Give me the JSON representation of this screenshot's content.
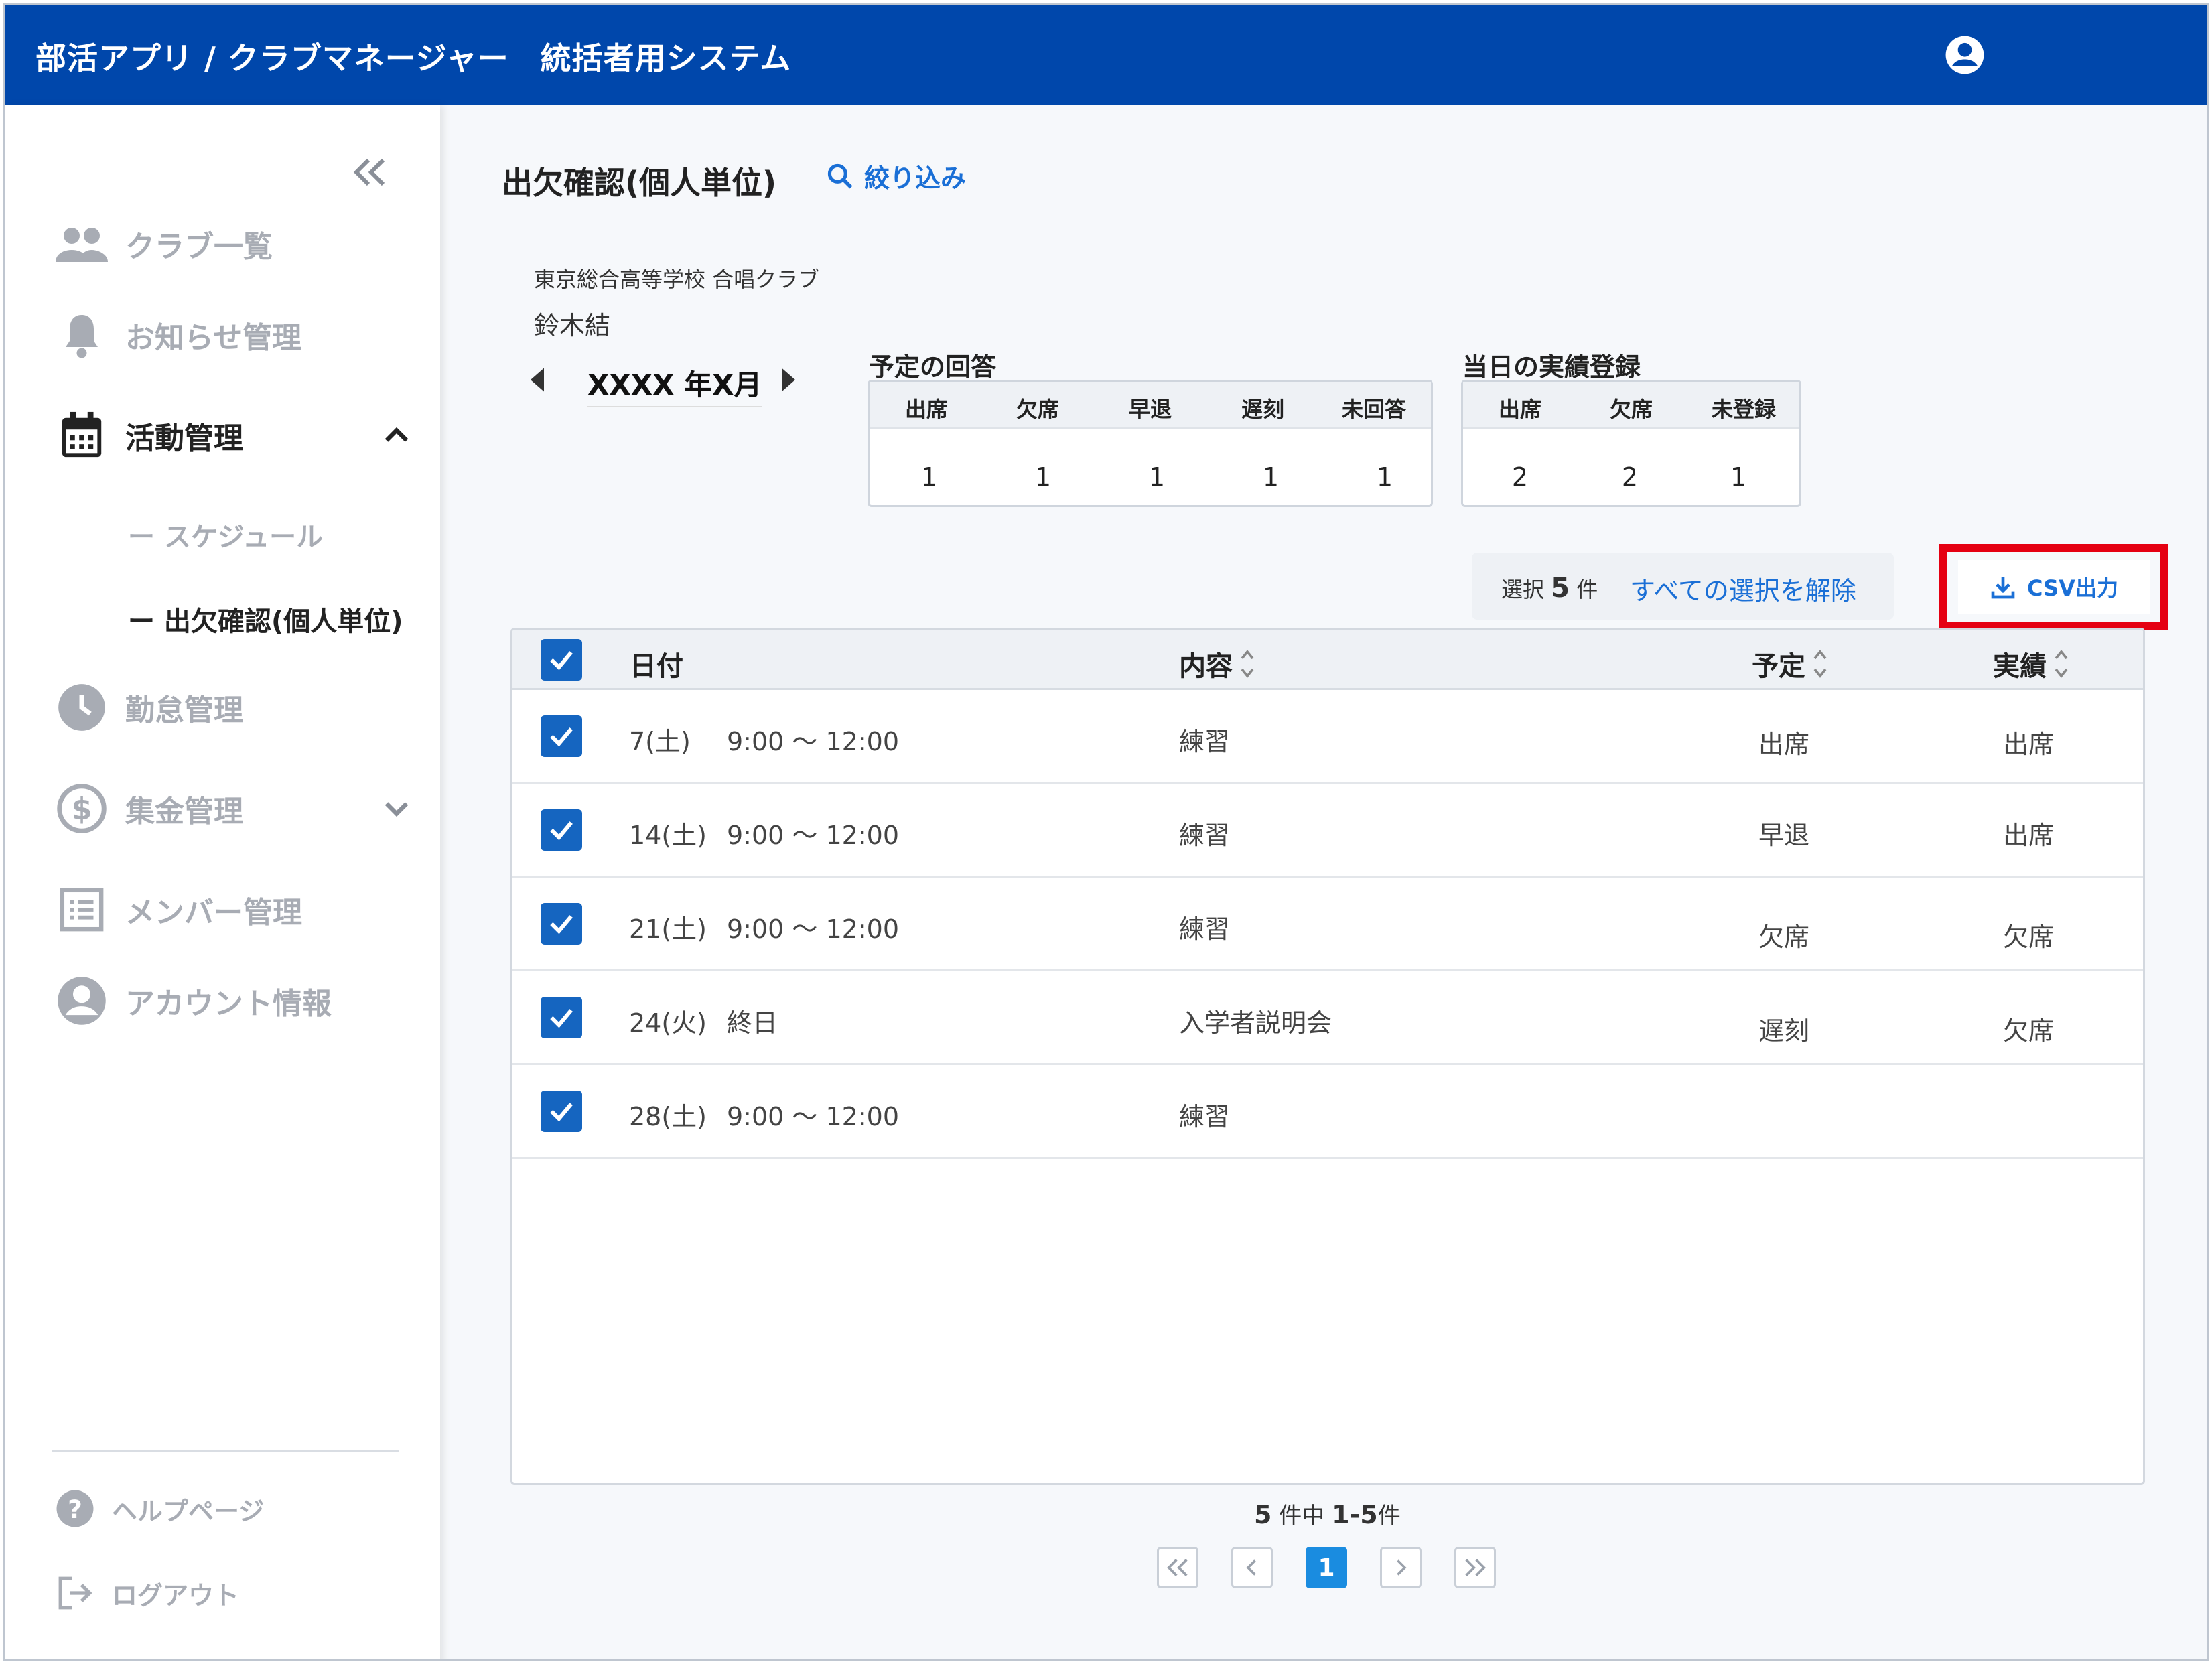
{
  "header": {
    "title": "部活アプリ / クラブマネージャー　統括者用システム",
    "account_icon": "account-circle-icon"
  },
  "sidebar": {
    "collapse_icon": "double-chevron-left-icon",
    "items": [
      {
        "label": "クラブ一覧",
        "icon": "people-icon"
      },
      {
        "label": "お知らせ管理",
        "icon": "bell-icon"
      },
      {
        "label": "活動管理",
        "icon": "calendar-icon",
        "expanded": true
      },
      {
        "label": "勤怠管理",
        "icon": "clock-icon"
      },
      {
        "label": "集金管理",
        "icon": "dollar-circle-icon",
        "expanded": false
      },
      {
        "label": "メンバー管理",
        "icon": "list-icon"
      },
      {
        "label": "アカウント情報",
        "icon": "account-circle-icon"
      }
    ],
    "sub_items": [
      {
        "label": "ー スケジュール"
      },
      {
        "label": "ー 出欠確認(個人単位)"
      }
    ],
    "footer": [
      {
        "label": "ヘルプページ",
        "icon": "help-icon"
      },
      {
        "label": "ログアウト",
        "icon": "logout-icon"
      }
    ]
  },
  "main": {
    "title": "出欠確認(個人単位)",
    "filter_label": "絞り込み",
    "club_name": "東京総合高等学校 合唱クラブ",
    "member_name": "鈴木結",
    "month": "XXXX 年X月",
    "planned_summary": {
      "title": "予定の回答",
      "headers": [
        "出席",
        "欠席",
        "早退",
        "遅刻",
        "未回答"
      ],
      "values": [
        "1",
        "1",
        "1",
        "1",
        "1"
      ]
    },
    "actual_summary": {
      "title": "当日の実績登録",
      "headers": [
        "出席",
        "欠席",
        "未登録"
      ],
      "values": [
        "2",
        "2",
        "1"
      ]
    },
    "selection": {
      "prefix": "選択",
      "count": "5",
      "suffix": "件",
      "clear_label": "すべての選択を解除"
    },
    "csv_label": "CSV出力",
    "table": {
      "headers": {
        "date": "日付",
        "content": "内容",
        "plan": "予定",
        "actual": "実績"
      },
      "rows": [
        {
          "day": "7(土)",
          "time": "9:00 ～ 12:00",
          "content": "練習",
          "plan": "出席",
          "actual": "出席",
          "checked": true
        },
        {
          "day": "14(土)",
          "time": "9:00 ～ 12:00",
          "content": "練習",
          "plan": "早退",
          "actual": "出席",
          "checked": true
        },
        {
          "day": "21(土)",
          "time": "9:00 ～ 12:00",
          "content": "練習",
          "plan": "欠席",
          "actual": "欠席",
          "checked": true
        },
        {
          "day": "24(火)",
          "time": "終日",
          "content": "入学者説明会",
          "plan": "遅刻",
          "actual": "欠席",
          "checked": true
        },
        {
          "day": "28(土)",
          "time": "9:00 ～ 12:00",
          "content": "練習",
          "plan": "",
          "actual": "",
          "checked": true
        }
      ]
    },
    "pagination": {
      "total": "5",
      "total_suffix": "件中",
      "range": "1-5",
      "range_suffix": "件",
      "current_page": "1"
    }
  },
  "colors": {
    "header_bg": "#0047ab",
    "accent": "#1a6fd6",
    "checkbox": "#1565c0",
    "highlight": "#e50012"
  }
}
